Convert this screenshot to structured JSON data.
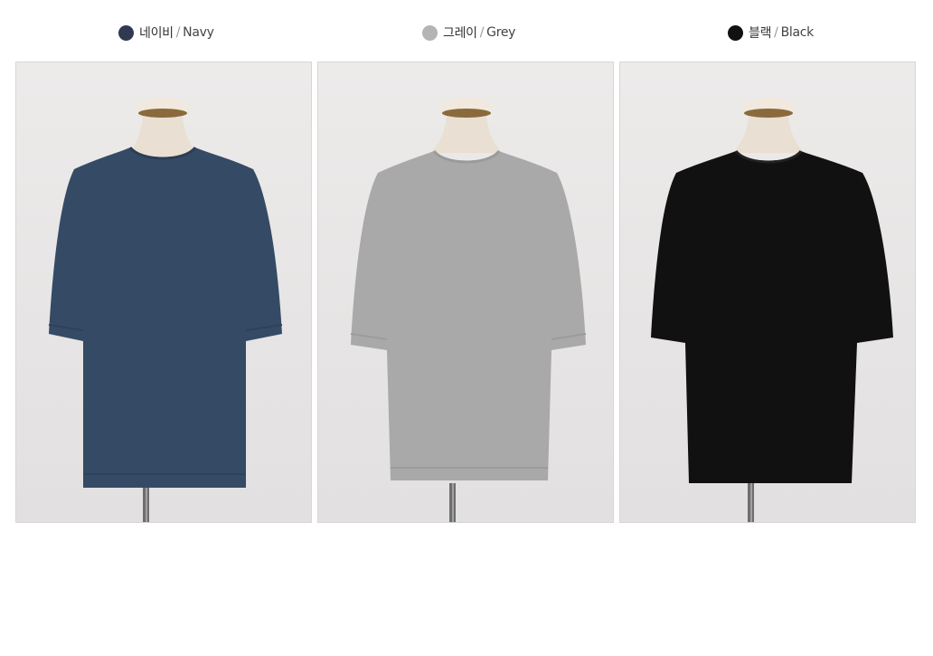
{
  "swatches": [
    {
      "ko": "네이비",
      "en": "Navy",
      "color": "#2f3a52",
      "garment_color": "#354a64"
    },
    {
      "ko": "그레이",
      "en": "Grey",
      "color": "#b4b4b4",
      "garment_color": "#a9a9a9"
    },
    {
      "ko": "블랙",
      "en": "Black",
      "color": "#111111",
      "garment_color": "#111111"
    }
  ],
  "separator": "/"
}
